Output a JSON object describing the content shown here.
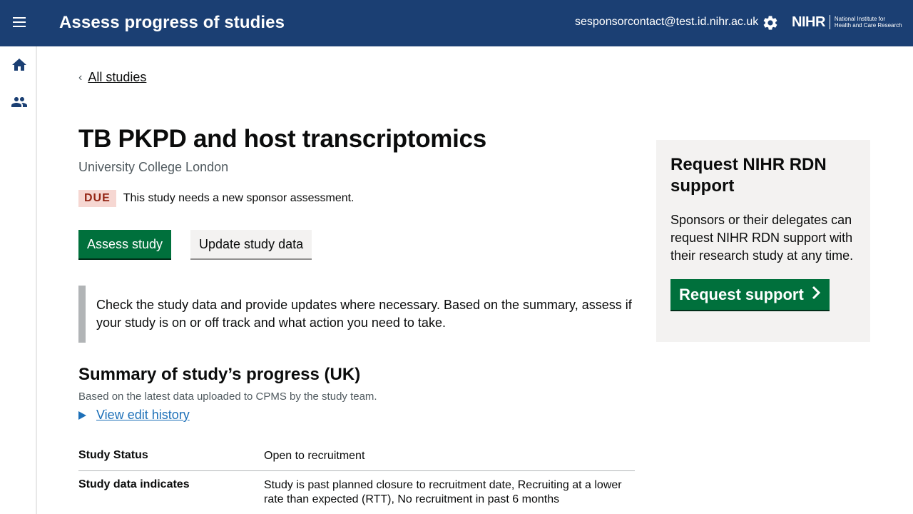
{
  "header": {
    "title": "Assess progress of studies",
    "user_email": "sesponsorcontact@test.id.nihr.ac.uk",
    "logo_main": "NIHR",
    "logo_sub_line1": "National Institute for",
    "logo_sub_line2": "Health and Care Research"
  },
  "back_link": "All studies",
  "study": {
    "title": "TB PKPD and host transcriptomics",
    "organisation": "University College London",
    "due_tag": "DUE",
    "status_text": "This study needs a new sponsor assessment."
  },
  "actions": {
    "assess": "Assess study",
    "update": "Update study data"
  },
  "inset_text": "Check the study data and provide updates where necessary. Based on the summary, assess if your study is on or off track and what action you need to take.",
  "summary": {
    "title": "Summary of study’s progress (UK)",
    "subtitle": "Based on the latest data uploaded to CPMS by the study team.",
    "history_link": "View edit history",
    "rows": [
      {
        "key": "Study Status",
        "value": "Open to recruitment"
      },
      {
        "key": "Study data indicates",
        "value": "Study is past planned closure to recruitment date, Recruiting at a lower rate than expected (RTT), No recruitment in past 6 months"
      }
    ]
  },
  "side_panel": {
    "title": "Request NIHR RDN support",
    "text": "Sponsors or their delegates can request NIHR RDN support with their research study at any time.",
    "button": "Request support"
  },
  "colors": {
    "header_bg": "#1b3f73",
    "primary_green": "#00703c",
    "link_blue": "#1d70b8",
    "due_bg": "#f6d7d2",
    "due_text": "#942514"
  }
}
